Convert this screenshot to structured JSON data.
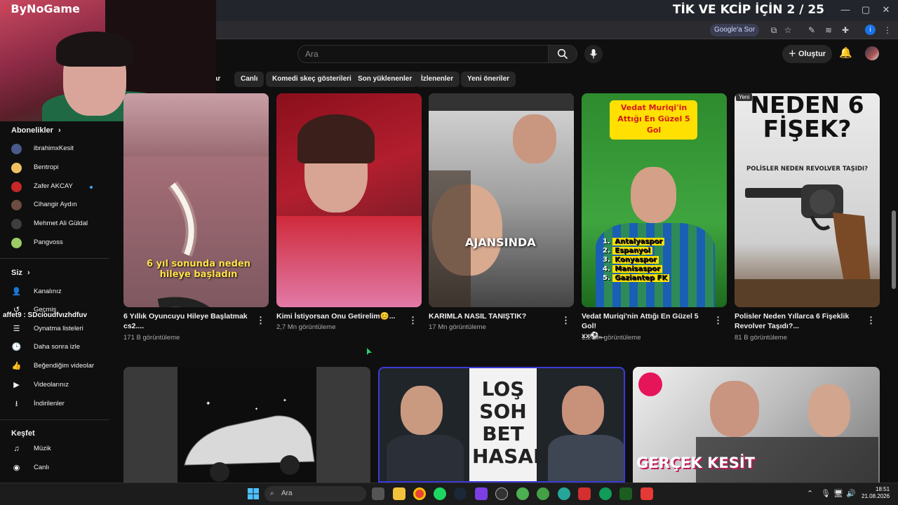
{
  "stream": {
    "title": "TİK VE KCİP İÇİN 2 / 25",
    "brand": "ByNoGame",
    "chat_overlay": "affet9 : SDcioudfvızhdfuv"
  },
  "window_controls": [
    "—",
    "▢",
    "✕"
  ],
  "browser": {
    "google_chip": "Google'a Sor",
    "profile_initial": "i"
  },
  "youtube_header": {
    "search_placeholder": "Ara",
    "create_label": "Oluştur"
  },
  "chips": [
    "lar",
    "Canlı",
    "Komedi skeç gösterileri",
    "Son yüklenenler",
    "İzlenenler",
    "Yeni öneriler"
  ],
  "sidebar": {
    "subscriptions_header": "Abonelikler",
    "subscriptions": [
      {
        "name": "ibrahimxKesit",
        "color": "#4a5a8a",
        "live": false
      },
      {
        "name": "Bentropi",
        "color": "#f0c060",
        "live": false
      },
      {
        "name": "Zafer AKCAY",
        "color": "#c62828",
        "live": true
      },
      {
        "name": "Cihangir Aydın",
        "color": "#6d4c41",
        "live": false
      },
      {
        "name": "Mehmet Ali Güldal",
        "color": "#3e3e3e",
        "live": false
      },
      {
        "name": "Pangvoss",
        "color": "#9ccc65",
        "live": false
      }
    ],
    "you_header": "Siz",
    "you_items": [
      {
        "label": "Kanalınız",
        "icon": "👤"
      },
      {
        "label": "Geçmiş",
        "icon": "↺"
      },
      {
        "label": "Oynatma listeleri",
        "icon": "☰"
      },
      {
        "label": "Daha sonra izle",
        "icon": "🕒"
      },
      {
        "label": "Beğendiğim videolar",
        "icon": "👍"
      },
      {
        "label": "Videolarınız",
        "icon": "▶"
      },
      {
        "label": "İndirilenler",
        "icon": "⭳"
      }
    ],
    "explore_header": "Keşfet",
    "explore_items": [
      {
        "label": "Müzik",
        "icon": "♫"
      },
      {
        "label": "Canlı",
        "icon": "◉"
      }
    ]
  },
  "videos_row1": [
    {
      "title_l1": "6 Yıllık Oyuncuyu Hileye Başlatmak",
      "title_l2": "cs2....",
      "meta": "171 B görüntüleme",
      "thumb_caption": "6 yıl sonunda neden hileye başladın"
    },
    {
      "title_l1": "Kimi İstiyorsan Onu Getirelim😊...",
      "title_l2": "",
      "meta": "2,7 Mn görüntüleme",
      "thumb_caption": ""
    },
    {
      "title_l1": "KARIMLA NASIL TANIŞTIK?",
      "title_l2": "",
      "meta": "17 Mn görüntüleme",
      "thumb_caption": "AJANSINDA"
    },
    {
      "title_l1": "Vedat Muriqi'nin Attığı En Güzel 5 Gol!",
      "title_l2": "xx⚽...",
      "meta": "1,2 Mn görüntüleme",
      "thumb_caption": "Vedat Muriqi'in Attığı En Güzel 5 Gol"
    },
    {
      "title_l1": "Polisler Neden Yıllarca 6 Fişeklik",
      "title_l2": "Revolver Taşıdı?...",
      "meta": "81 B görüntüleme",
      "thumb_caption": "NEDEN 6 FİŞEK?",
      "thumb_sub": "POLİSLER NEDEN REVOLVER TAŞIDI?",
      "badge": "Yeni"
    }
  ],
  "goals_list": [
    "Antalyaspor",
    "Espanyol",
    "Konyaspor",
    "Manisaspor",
    "Gaziantep FK"
  ],
  "videos_row2": [
    {
      "thumb_caption": ""
    },
    {
      "thumb_caption": "LOŞ SOH BET HASAN"
    },
    {
      "thumb_caption": "GERÇEK KESİT"
    }
  ],
  "taskbar": {
    "search_placeholder": "Ara",
    "time": "18:51",
    "date": "21.08.2026"
  }
}
